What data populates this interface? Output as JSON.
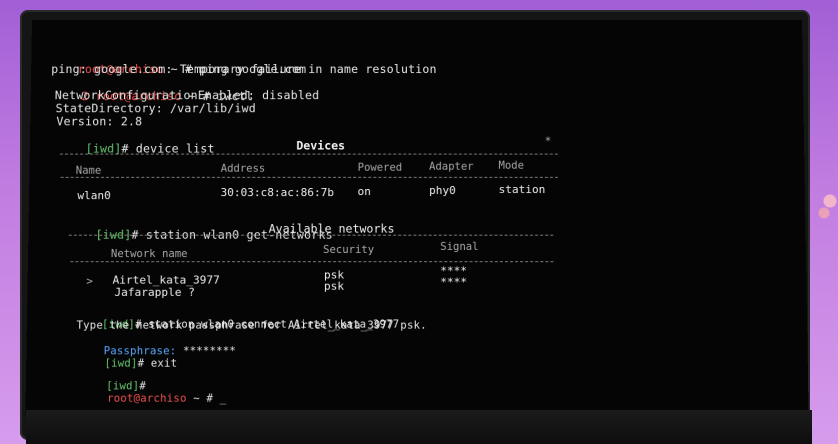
{
  "terminal": {
    "line1_user": "root@archiso",
    "line1_rest": " ~ # ping google.com",
    "line2": "ping: google.com: Temporary failure in name resolution",
    "line3_code": "2",
    "line3_user": "root@archiso",
    "line3_rest": " ~ # iwctl",
    "line4": "NetworkConfigurationEnabled: disabled",
    "line5": "StateDirectory: /var/lib/iwd",
    "line6": "Version: 2.8",
    "prompt_iwd": "[iwd]",
    "cmd_device_list": "# device list",
    "cmd_get_networks": "# station wlan0 get-networks",
    "cmd_connect": "# station wlan0 connect Airtel_kata_3977",
    "passphrase_msg": "Type the network passphrase for Airtel_kata_3977 psk.",
    "passphrase_label": "Passphrase:",
    "passphrase_value": " ********",
    "cmd_exit": "# exit",
    "cmd_empty": "#",
    "final_user": "root@archiso",
    "final_rest": " ~ # _"
  },
  "devices_table": {
    "title": "Devices",
    "star": "*",
    "headers": [
      "Name",
      "Address",
      "Powered",
      "Adapter",
      "Mode"
    ],
    "rows": [
      [
        "wlan0",
        "30:03:c8:ac:86:7b",
        "on",
        "phy0",
        "station"
      ]
    ]
  },
  "networks_table": {
    "title": "Available networks",
    "headers": [
      "Network name",
      "Security",
      "Signal"
    ],
    "rows": [
      {
        "marker": ">",
        "name": "Airtel_kata_3977",
        "security": "psk",
        "signal": "****"
      },
      {
        "marker": "",
        "name": "Jafarapple ?",
        "security": "psk",
        "signal": "****"
      }
    ]
  }
}
